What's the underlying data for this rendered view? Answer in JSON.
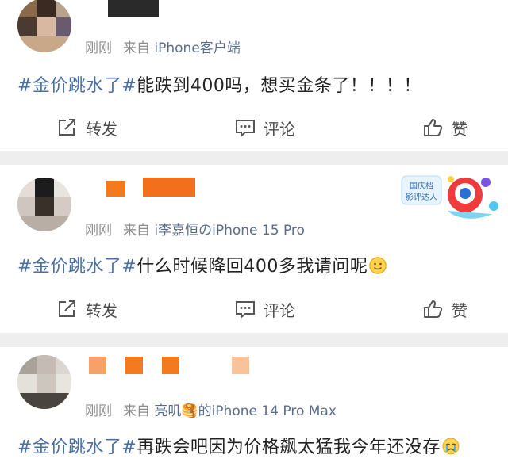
{
  "posts": [
    {
      "time": "刚刚",
      "source_prefix": "来自",
      "source_app": "iPhone客户端",
      "topic": "#金价跳水了#",
      "text": "能跌到400吗，想买金条了！！！！",
      "emoji": ""
    },
    {
      "time": "刚刚",
      "source_prefix": "来自",
      "source_app": "i李嘉恒のiPhone 15 Pro",
      "topic": "#金价跳水了#",
      "text": "什么时候降回400多我请问呢",
      "emoji": "slight-smile-emoji",
      "badge_text": "国庆档影评达人"
    },
    {
      "time": "刚刚",
      "source_prefix": "来自",
      "source_app": "亮叽🥞的iPhone 14 Pro Max",
      "topic": "#金价跳水了#",
      "text": "再跌会吧因为价格飙太猛我今年还没存",
      "emoji": "crying-emoji"
    }
  ],
  "actions": {
    "repost": "转发",
    "comment": "评论",
    "like": "赞"
  },
  "colors": {
    "topic": "#4a6fa5",
    "meta": "#8b8b8b",
    "divider": "#eeeeee",
    "mosaic_orange": "#f47a20"
  }
}
